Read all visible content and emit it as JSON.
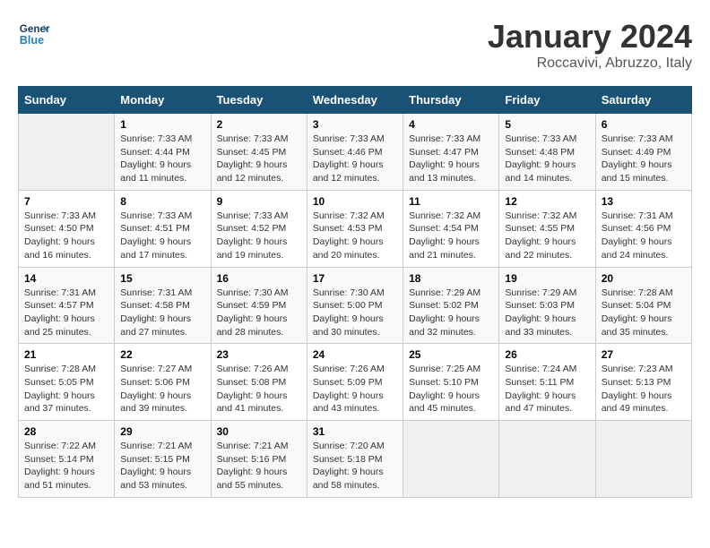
{
  "header": {
    "logo_line1": "General",
    "logo_line2": "Blue",
    "month": "January 2024",
    "location": "Roccavivi, Abruzzo, Italy"
  },
  "days_of_week": [
    "Sunday",
    "Monday",
    "Tuesday",
    "Wednesday",
    "Thursday",
    "Friday",
    "Saturday"
  ],
  "weeks": [
    [
      {
        "day": "",
        "info": ""
      },
      {
        "day": "1",
        "info": "Sunrise: 7:33 AM\nSunset: 4:44 PM\nDaylight: 9 hours\nand 11 minutes."
      },
      {
        "day": "2",
        "info": "Sunrise: 7:33 AM\nSunset: 4:45 PM\nDaylight: 9 hours\nand 12 minutes."
      },
      {
        "day": "3",
        "info": "Sunrise: 7:33 AM\nSunset: 4:46 PM\nDaylight: 9 hours\nand 12 minutes."
      },
      {
        "day": "4",
        "info": "Sunrise: 7:33 AM\nSunset: 4:47 PM\nDaylight: 9 hours\nand 13 minutes."
      },
      {
        "day": "5",
        "info": "Sunrise: 7:33 AM\nSunset: 4:48 PM\nDaylight: 9 hours\nand 14 minutes."
      },
      {
        "day": "6",
        "info": "Sunrise: 7:33 AM\nSunset: 4:49 PM\nDaylight: 9 hours\nand 15 minutes."
      }
    ],
    [
      {
        "day": "7",
        "info": "Sunrise: 7:33 AM\nSunset: 4:50 PM\nDaylight: 9 hours\nand 16 minutes."
      },
      {
        "day": "8",
        "info": "Sunrise: 7:33 AM\nSunset: 4:51 PM\nDaylight: 9 hours\nand 17 minutes."
      },
      {
        "day": "9",
        "info": "Sunrise: 7:33 AM\nSunset: 4:52 PM\nDaylight: 9 hours\nand 19 minutes."
      },
      {
        "day": "10",
        "info": "Sunrise: 7:32 AM\nSunset: 4:53 PM\nDaylight: 9 hours\nand 20 minutes."
      },
      {
        "day": "11",
        "info": "Sunrise: 7:32 AM\nSunset: 4:54 PM\nDaylight: 9 hours\nand 21 minutes."
      },
      {
        "day": "12",
        "info": "Sunrise: 7:32 AM\nSunset: 4:55 PM\nDaylight: 9 hours\nand 22 minutes."
      },
      {
        "day": "13",
        "info": "Sunrise: 7:31 AM\nSunset: 4:56 PM\nDaylight: 9 hours\nand 24 minutes."
      }
    ],
    [
      {
        "day": "14",
        "info": "Sunrise: 7:31 AM\nSunset: 4:57 PM\nDaylight: 9 hours\nand 25 minutes."
      },
      {
        "day": "15",
        "info": "Sunrise: 7:31 AM\nSunset: 4:58 PM\nDaylight: 9 hours\nand 27 minutes."
      },
      {
        "day": "16",
        "info": "Sunrise: 7:30 AM\nSunset: 4:59 PM\nDaylight: 9 hours\nand 28 minutes."
      },
      {
        "day": "17",
        "info": "Sunrise: 7:30 AM\nSunset: 5:00 PM\nDaylight: 9 hours\nand 30 minutes."
      },
      {
        "day": "18",
        "info": "Sunrise: 7:29 AM\nSunset: 5:02 PM\nDaylight: 9 hours\nand 32 minutes."
      },
      {
        "day": "19",
        "info": "Sunrise: 7:29 AM\nSunset: 5:03 PM\nDaylight: 9 hours\nand 33 minutes."
      },
      {
        "day": "20",
        "info": "Sunrise: 7:28 AM\nSunset: 5:04 PM\nDaylight: 9 hours\nand 35 minutes."
      }
    ],
    [
      {
        "day": "21",
        "info": "Sunrise: 7:28 AM\nSunset: 5:05 PM\nDaylight: 9 hours\nand 37 minutes."
      },
      {
        "day": "22",
        "info": "Sunrise: 7:27 AM\nSunset: 5:06 PM\nDaylight: 9 hours\nand 39 minutes."
      },
      {
        "day": "23",
        "info": "Sunrise: 7:26 AM\nSunset: 5:08 PM\nDaylight: 9 hours\nand 41 minutes."
      },
      {
        "day": "24",
        "info": "Sunrise: 7:26 AM\nSunset: 5:09 PM\nDaylight: 9 hours\nand 43 minutes."
      },
      {
        "day": "25",
        "info": "Sunrise: 7:25 AM\nSunset: 5:10 PM\nDaylight: 9 hours\nand 45 minutes."
      },
      {
        "day": "26",
        "info": "Sunrise: 7:24 AM\nSunset: 5:11 PM\nDaylight: 9 hours\nand 47 minutes."
      },
      {
        "day": "27",
        "info": "Sunrise: 7:23 AM\nSunset: 5:13 PM\nDaylight: 9 hours\nand 49 minutes."
      }
    ],
    [
      {
        "day": "28",
        "info": "Sunrise: 7:22 AM\nSunset: 5:14 PM\nDaylight: 9 hours\nand 51 minutes."
      },
      {
        "day": "29",
        "info": "Sunrise: 7:21 AM\nSunset: 5:15 PM\nDaylight: 9 hours\nand 53 minutes."
      },
      {
        "day": "30",
        "info": "Sunrise: 7:21 AM\nSunset: 5:16 PM\nDaylight: 9 hours\nand 55 minutes."
      },
      {
        "day": "31",
        "info": "Sunrise: 7:20 AM\nSunset: 5:18 PM\nDaylight: 9 hours\nand 58 minutes."
      },
      {
        "day": "",
        "info": ""
      },
      {
        "day": "",
        "info": ""
      },
      {
        "day": "",
        "info": ""
      }
    ]
  ]
}
